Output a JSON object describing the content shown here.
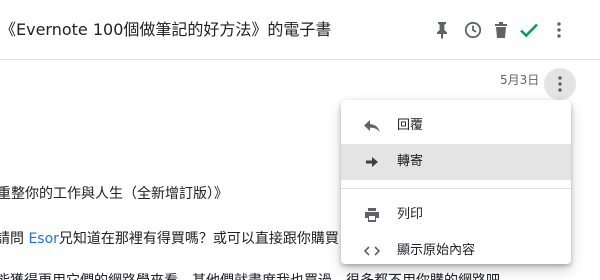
{
  "header": {
    "subject": "《Evernote 100個做筆記的好方法》的電子書",
    "icons": [
      "pin-icon",
      "clock-icon",
      "trash-icon",
      "check-icon",
      "more-vert-icon"
    ],
    "check_color": "#0f9d58"
  },
  "message": {
    "date": "5月3日",
    "body": {
      "line1": "重整你的工作與人生（全新增訂版）》",
      "line2_before": "請問 ",
      "line2_link": "Esor",
      "line2_after": "兄知道在那裡有得買嗎？或可以直接跟你購買",
      "line3": "能獲得更用它們的網路學來看，甚他們就盡度我也買過，很多都不用你購的網路吧"
    }
  },
  "menu": {
    "items": [
      {
        "label": "回覆",
        "icon": "reply-icon"
      },
      {
        "label": "轉寄",
        "icon": "forward-icon",
        "active": true
      },
      {
        "label": "列印",
        "icon": "print-icon"
      },
      {
        "label": "顯示原始內容",
        "icon": "code-icon"
      }
    ]
  },
  "colors": {
    "link": "#1a73e8",
    "icon": "#5f6368",
    "menu_active": "#e4e4e4"
  }
}
